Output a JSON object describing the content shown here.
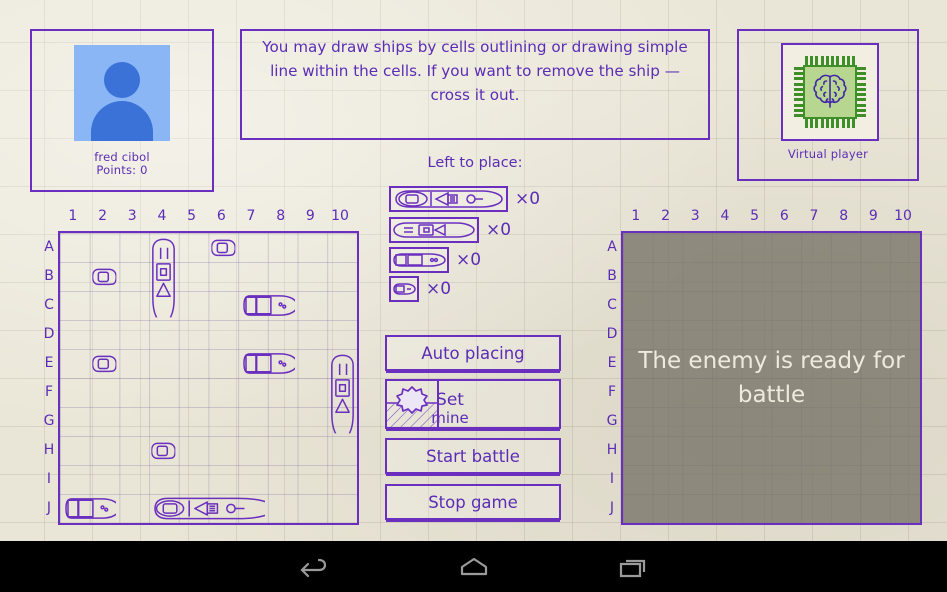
{
  "player": {
    "name": "fred cibol",
    "points_label": "Points: 0",
    "avatar_icon": "person-avatar-icon"
  },
  "instructions": {
    "text": "You may draw ships by cells outlining or drawing simple line within the cells. If you want to remove the ship — cross it out."
  },
  "enemy": {
    "name": "Virtual player",
    "avatar_icon": "brain-chip-icon",
    "overlay_text": "The enemy is ready for battle"
  },
  "fleet_panel": {
    "title": "Left to place:",
    "items": [
      {
        "size": 4,
        "count_label": "×0",
        "icon": "battleship-4-icon"
      },
      {
        "size": 3,
        "count_label": "×0",
        "icon": "cruiser-3-icon"
      },
      {
        "size": 2,
        "count_label": "×0",
        "icon": "destroyer-2-icon"
      },
      {
        "size": 1,
        "count_label": "×0",
        "icon": "boat-1-icon"
      }
    ]
  },
  "buttons": {
    "auto_placing": "Auto placing",
    "set_mine_line1": "Set",
    "set_mine_line2": "mine",
    "set_mine_icon": "sea-mine-icon",
    "start_battle": "Start battle",
    "stop_game": "Stop game"
  },
  "boards": {
    "columns": [
      "1",
      "2",
      "3",
      "4",
      "5",
      "6",
      "7",
      "8",
      "9",
      "10"
    ],
    "rows": [
      "A",
      "B",
      "C",
      "D",
      "E",
      "F",
      "G",
      "H",
      "I",
      "J"
    ],
    "player_ships": [
      {
        "row": "A",
        "col": 6,
        "size": 1,
        "orientation": "vertical"
      },
      {
        "row": "A",
        "col": 4,
        "size": 3,
        "orientation": "vertical"
      },
      {
        "row": "B",
        "col": 2,
        "size": 1,
        "orientation": "vertical"
      },
      {
        "row": "C",
        "col": 7,
        "size": 2,
        "orientation": "horizontal"
      },
      {
        "row": "E",
        "col": 2,
        "size": 1,
        "orientation": "vertical"
      },
      {
        "row": "E",
        "col": 7,
        "size": 2,
        "orientation": "horizontal"
      },
      {
        "row": "E",
        "col": 10,
        "size": 3,
        "orientation": "vertical"
      },
      {
        "row": "H",
        "col": 4,
        "size": 1,
        "orientation": "vertical"
      },
      {
        "row": "J",
        "col": 1,
        "size": 2,
        "orientation": "horizontal"
      },
      {
        "row": "J",
        "col": 4,
        "size": 4,
        "orientation": "horizontal"
      }
    ],
    "enemy_ships": []
  },
  "navbar": {
    "back": "back-icon",
    "home": "home-icon",
    "recents": "recents-icon"
  },
  "colors": {
    "ink": "#5b2db5",
    "ink_border": "#6a2fbf",
    "paper": "#eae6d7",
    "avatar_bg": "#8ab6f5",
    "avatar_fg": "#3a72d8",
    "chip_green": "#b7d690",
    "overlay": "rgba(120,116,104,0.80)"
  }
}
